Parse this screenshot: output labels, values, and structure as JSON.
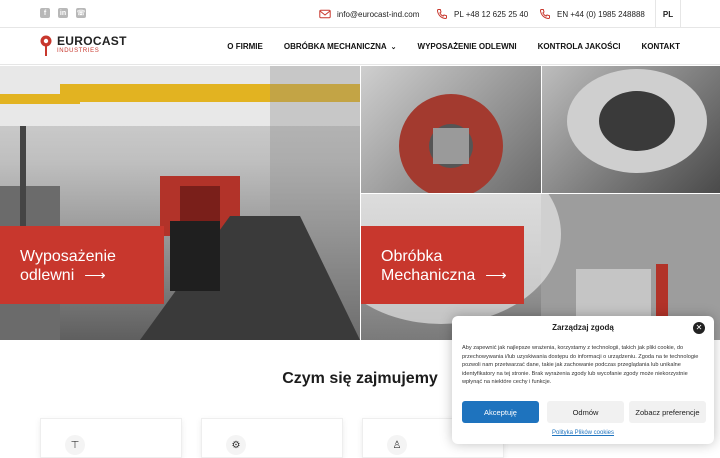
{
  "topbar": {
    "social": [
      {
        "name": "facebook-icon",
        "glyph": "f"
      },
      {
        "name": "linkedin-icon",
        "glyph": "in"
      },
      {
        "name": "phone-icon",
        "glyph": "☏"
      }
    ],
    "email": "info@eurocast-ind.com",
    "phone_pl": "PL +48 12 625 25 40",
    "phone_en": "EN +44 (0) 1985 248888",
    "language": "PL"
  },
  "logo": {
    "name": "EUROCAST",
    "sub": "INDUSTRIES"
  },
  "nav": {
    "items": [
      "O FIRMIE",
      "OBRÓBKA MECHANICZNA",
      "WYPOSAŻENIE ODLEWNI",
      "KONTROLA JAKOŚCI",
      "KONTAKT"
    ]
  },
  "hero": {
    "cta1": {
      "line1": "Wyposażenie",
      "line2": "odlewni"
    },
    "cta2": {
      "line1": "Obróbka",
      "line2": "Mechaniczna"
    }
  },
  "section": {
    "title": "Czym się zajmujemy"
  },
  "cookie": {
    "title": "Zarządzaj zgodą",
    "text": "Aby zapewnić jak najlepsze wrażenia, korzystamy z technologii, takich jak pliki cookie, do przechowywania i/lub uzyskiwania dostępu do informacji o urządzeniu. Zgoda na te technologie pozwoli nam przetwarzać dane, takie jak zachowanie podczas przeglądania lub unikalne identyfikatory na tej stronie. Brak wyrażenia zgody lub wycofanie zgody może niekorzystnie wpłynąć na niektóre cechy i funkcje.",
    "accept": "Akceptuję",
    "deny": "Odmów",
    "preferences": "Zobacz preferencje",
    "policy_link": "Polityka Plików cookies"
  },
  "colors": {
    "brand": "#c8372d",
    "accept": "#1e73be"
  }
}
